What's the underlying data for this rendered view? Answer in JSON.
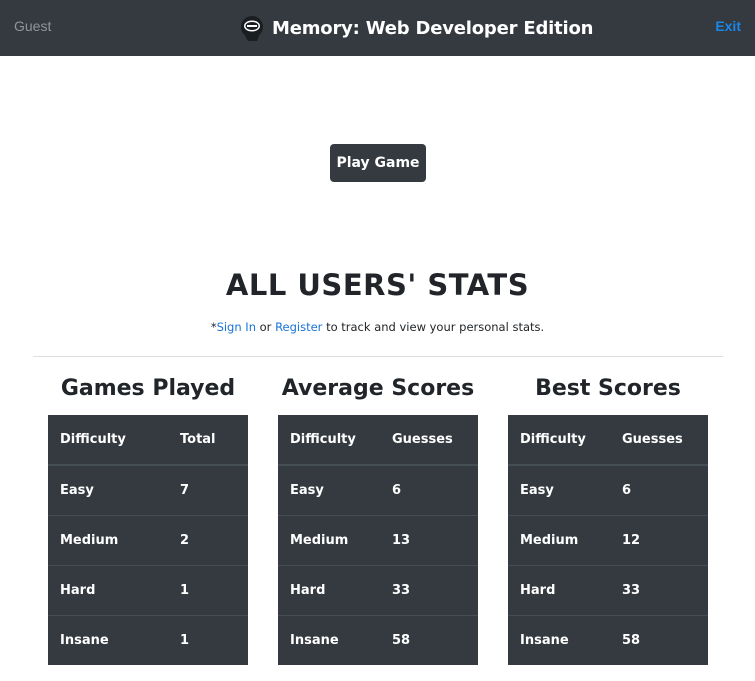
{
  "navbar": {
    "guest_label": "Guest",
    "title": "Memory: Web Developer Edition",
    "exit_label": "Exit",
    "logo_icon": "brain-head-icon"
  },
  "main": {
    "play_button_label": "Play Game",
    "stats_title": "ALL USERS' STATS",
    "signin_prefix": "*",
    "signin_link": "Sign In",
    "or_text": " or ",
    "register_link": "Register",
    "signin_suffix": " to track and view your personal stats."
  },
  "tables": {
    "games_played": {
      "heading": "Games Played",
      "col1": "Difficulty",
      "col2": "Total",
      "rows": [
        {
          "difficulty": "Easy",
          "value": "7"
        },
        {
          "difficulty": "Medium",
          "value": "2"
        },
        {
          "difficulty": "Hard",
          "value": "1"
        },
        {
          "difficulty": "Insane",
          "value": "1"
        }
      ]
    },
    "average_scores": {
      "heading": "Average Scores",
      "col1": "Difficulty",
      "col2": "Guesses",
      "rows": [
        {
          "difficulty": "Easy",
          "value": "6"
        },
        {
          "difficulty": "Medium",
          "value": "13"
        },
        {
          "difficulty": "Hard",
          "value": "33"
        },
        {
          "difficulty": "Insane",
          "value": "58"
        }
      ]
    },
    "best_scores": {
      "heading": "Best Scores",
      "col1": "Difficulty",
      "col2": "Guesses",
      "rows": [
        {
          "difficulty": "Easy",
          "value": "6"
        },
        {
          "difficulty": "Medium",
          "value": "12"
        },
        {
          "difficulty": "Hard",
          "value": "33"
        },
        {
          "difficulty": "Insane",
          "value": "58"
        }
      ]
    }
  },
  "colors": {
    "navbar_bg": "#343a40",
    "link": "#1a86e8",
    "table_bg": "#343a40"
  }
}
